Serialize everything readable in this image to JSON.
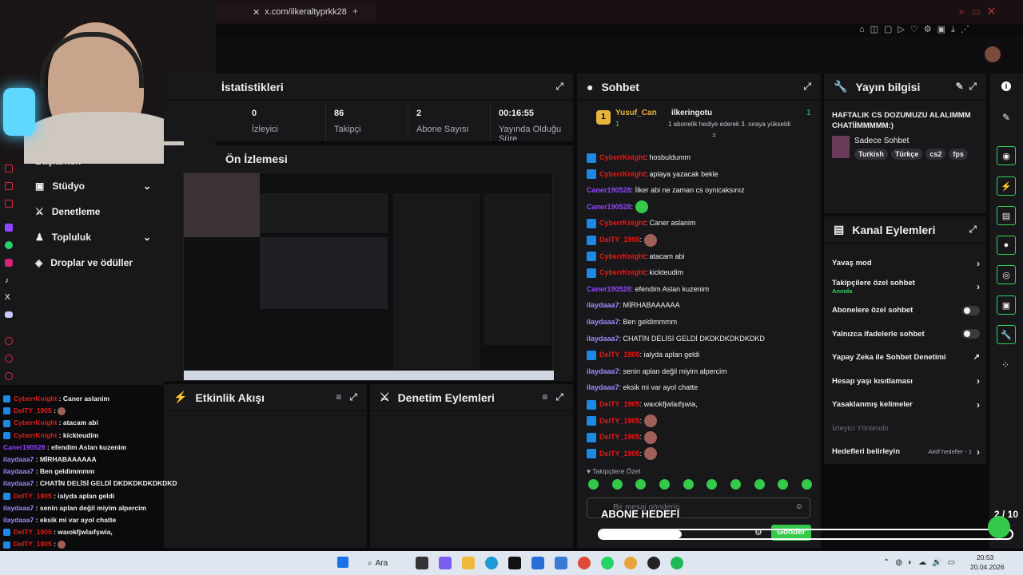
{
  "browser": {
    "tab_url": "x.com/ilkeraltyprkk28",
    "tab_plus": "+"
  },
  "stats": {
    "title": "İstatistikleri",
    "items": [
      {
        "value": "0",
        "label": "İzleyici"
      },
      {
        "value": "86",
        "label": "Takipçi"
      },
      {
        "value": "2",
        "label": "Abone Sayısı"
      },
      {
        "value": "00:16:55",
        "label": "Yayında Olduğu Süre"
      }
    ]
  },
  "preview": {
    "title": "Ön İzlemesi"
  },
  "activity": {
    "title": "Etkinlik Akışı"
  },
  "modactions": {
    "title": "Denetim Eylemleri"
  },
  "sidebar": {
    "items": [
      {
        "label": "Başlarken"
      },
      {
        "label": "Stüdyo"
      },
      {
        "label": "Denetleme"
      },
      {
        "label": "Topluluk"
      },
      {
        "label": "Droplar ve ödüller"
      }
    ]
  },
  "chat": {
    "title": "Sohbet",
    "pinned": {
      "user": "Yusuf_Can",
      "count": "1",
      "gifter": "ilkeringotu",
      "gift_count": "1",
      "gift_text": "1 abonelik hediye ederek 3. sıraya yükseldi"
    },
    "messages": [
      {
        "user": "CyberrKnight",
        "text": "hosbuldumm",
        "color": "#e91916",
        "mod": true
      },
      {
        "user": "CyberrKnight",
        "text": "aplaya yazacak bekle",
        "color": "#e91916",
        "mod": true
      },
      {
        "user": "Caner190528",
        "text": "İlker abi ne zaman cs oynicaksınız",
        "color": "#9147ff",
        "mod": false
      },
      {
        "user": "Caner190528",
        "text": "",
        "color": "#9147ff",
        "mod": false,
        "emote": true
      },
      {
        "user": "CyberrKnight",
        "text": "Caner aslanim",
        "color": "#e91916",
        "mod": true
      },
      {
        "user": "DeITY_1905",
        "text": "",
        "color": "#e91916",
        "mod": true,
        "emote": true
      },
      {
        "user": "CyberrKnight",
        "text": "atacam abi",
        "color": "#e91916",
        "mod": true
      },
      {
        "user": "CyberrKnight",
        "text": "kickteudim",
        "color": "#e91916",
        "mod": true
      },
      {
        "user": "Caner190528",
        "text": "efendim Aslan kuzenim",
        "color": "#9147ff",
        "mod": false
      },
      {
        "user": "ilaydaaa7",
        "text": "MİRHABAAAAAA",
        "color": "#9b8cff",
        "mod": false
      },
      {
        "user": "ilaydaaa7",
        "text": "Ben geldimmmm",
        "color": "#9b8cff",
        "mod": false
      },
      {
        "user": "ilaydaaa7",
        "text": "CHATİN DELİSİ GELDİ DKDKDKDKDKDKD",
        "color": "#9b8cff",
        "mod": false
      },
      {
        "user": "DeITY_1905",
        "text": "ialyda aplan geldi",
        "color": "#e91916",
        "mod": true
      },
      {
        "user": "ilaydaaa7",
        "text": "senin aplan değil miyim alpercim",
        "color": "#9b8cff",
        "mod": false
      },
      {
        "user": "ilaydaaa7",
        "text": "eksik mi var ayol chatte",
        "color": "#9b8cff",
        "mod": false
      },
      {
        "user": "DeITY_1905",
        "text": "waıokfjwlaıfşwia,",
        "color": "#e91916",
        "mod": true
      },
      {
        "user": "DeITY_1905",
        "text": "",
        "color": "#e91916",
        "mod": true,
        "emote": true
      },
      {
        "user": "DeITY_1905",
        "text": "",
        "color": "#e91916",
        "mod": true,
        "emote": true
      },
      {
        "user": "DeITY_1905",
        "text": "",
        "color": "#e91916",
        "mod": true,
        "emote": true
      }
    ],
    "followers_only": "Takipçilere Özel",
    "placeholder": "Bir mesaj gönderin",
    "send": "Gönder"
  },
  "overlay": {
    "goal": "ABONE HEDEFİ",
    "count": "2 / 10"
  },
  "streaminfo": {
    "title": "Yayın bilgisi",
    "headline": "HAFTALIK CS DOZUMUZU ALALIMMM CHATİİMMMMM:)",
    "category": "Sadece Sohbet",
    "tags": [
      "Turkish",
      "Türkçe",
      "cs2",
      "fps"
    ]
  },
  "channel": {
    "title": "Kanal Eylemleri",
    "rows": [
      {
        "label": "Yavaş mod",
        "sub": "",
        "type": "arrow"
      },
      {
        "label": "Takipçilere özel sohbet",
        "sub": "Anında",
        "type": "arrow"
      },
      {
        "label": "Abonelere özel sohbet",
        "sub": "",
        "type": "toggle"
      },
      {
        "label": "Yalnızca ifadelerle sohbet",
        "sub": "",
        "type": "toggle"
      },
      {
        "label": "Yapay Zeka ile Sohbet Denetimi",
        "sub": "",
        "type": "ext"
      },
      {
        "label": "Hesap yaşı kısıtlaması",
        "sub": "",
        "type": "arrow"
      },
      {
        "label": "Yasaklanmış kelimeler",
        "sub": "",
        "type": "arrow"
      },
      {
        "label": "İzleyici Yönlendir",
        "sub": "",
        "type": "dim"
      },
      {
        "label": "Hedefleri belirleyin",
        "sub": "Aktif hedefler - 1",
        "type": "arrow"
      }
    ]
  },
  "leftchat": [
    {
      "user": "CyberrKnight",
      "text": "Caner aslanim",
      "color": "#e91916"
    },
    {
      "user": "DeITY_1905",
      "text": "",
      "color": "#e91916"
    },
    {
      "user": "CyberrKnight",
      "text": "atacam abi",
      "color": "#e91916"
    },
    {
      "user": "CyberrKnight",
      "text": "kickteudim",
      "color": "#e91916"
    },
    {
      "user": "Caner190528",
      "text": "efendim Aslan kuzenim",
      "color": "#9147ff"
    },
    {
      "user": "ilaydaaa7",
      "text": "MİRHABAAAAAA",
      "color": "#9b8cff"
    },
    {
      "user": "ilaydaaa7",
      "text": "Ben geldimmmm",
      "color": "#9b8cff"
    },
    {
      "user": "ilaydaaa7",
      "text": "CHATİN DELİSİ GELDİ DKDKDKDKDKDKD",
      "color": "#9b8cff"
    },
    {
      "user": "DeITY_1905",
      "text": "ialyda aplan geldi",
      "color": "#e91916"
    },
    {
      "user": "ilaydaaa7",
      "text": "senin aplan değil miyim alpercim",
      "color": "#9b8cff"
    },
    {
      "user": "ilaydaaa7",
      "text": "eksik mi var ayol chatte",
      "color": "#9b8cff"
    },
    {
      "user": "DeITY_1905",
      "text": "waıokfjwlaıfşwia,",
      "color": "#e91916"
    },
    {
      "user": "DeITY_1905",
      "text": "",
      "color": "#e91916"
    },
    {
      "user": "DeITY_1905",
      "text": "",
      "color": "#e91916"
    },
    {
      "user": "DeITY_1905",
      "text": "",
      "color": "#e91916"
    }
  ],
  "taskbar": {
    "search": "Ara",
    "time": "20:53",
    "date": "20.04.2026"
  }
}
